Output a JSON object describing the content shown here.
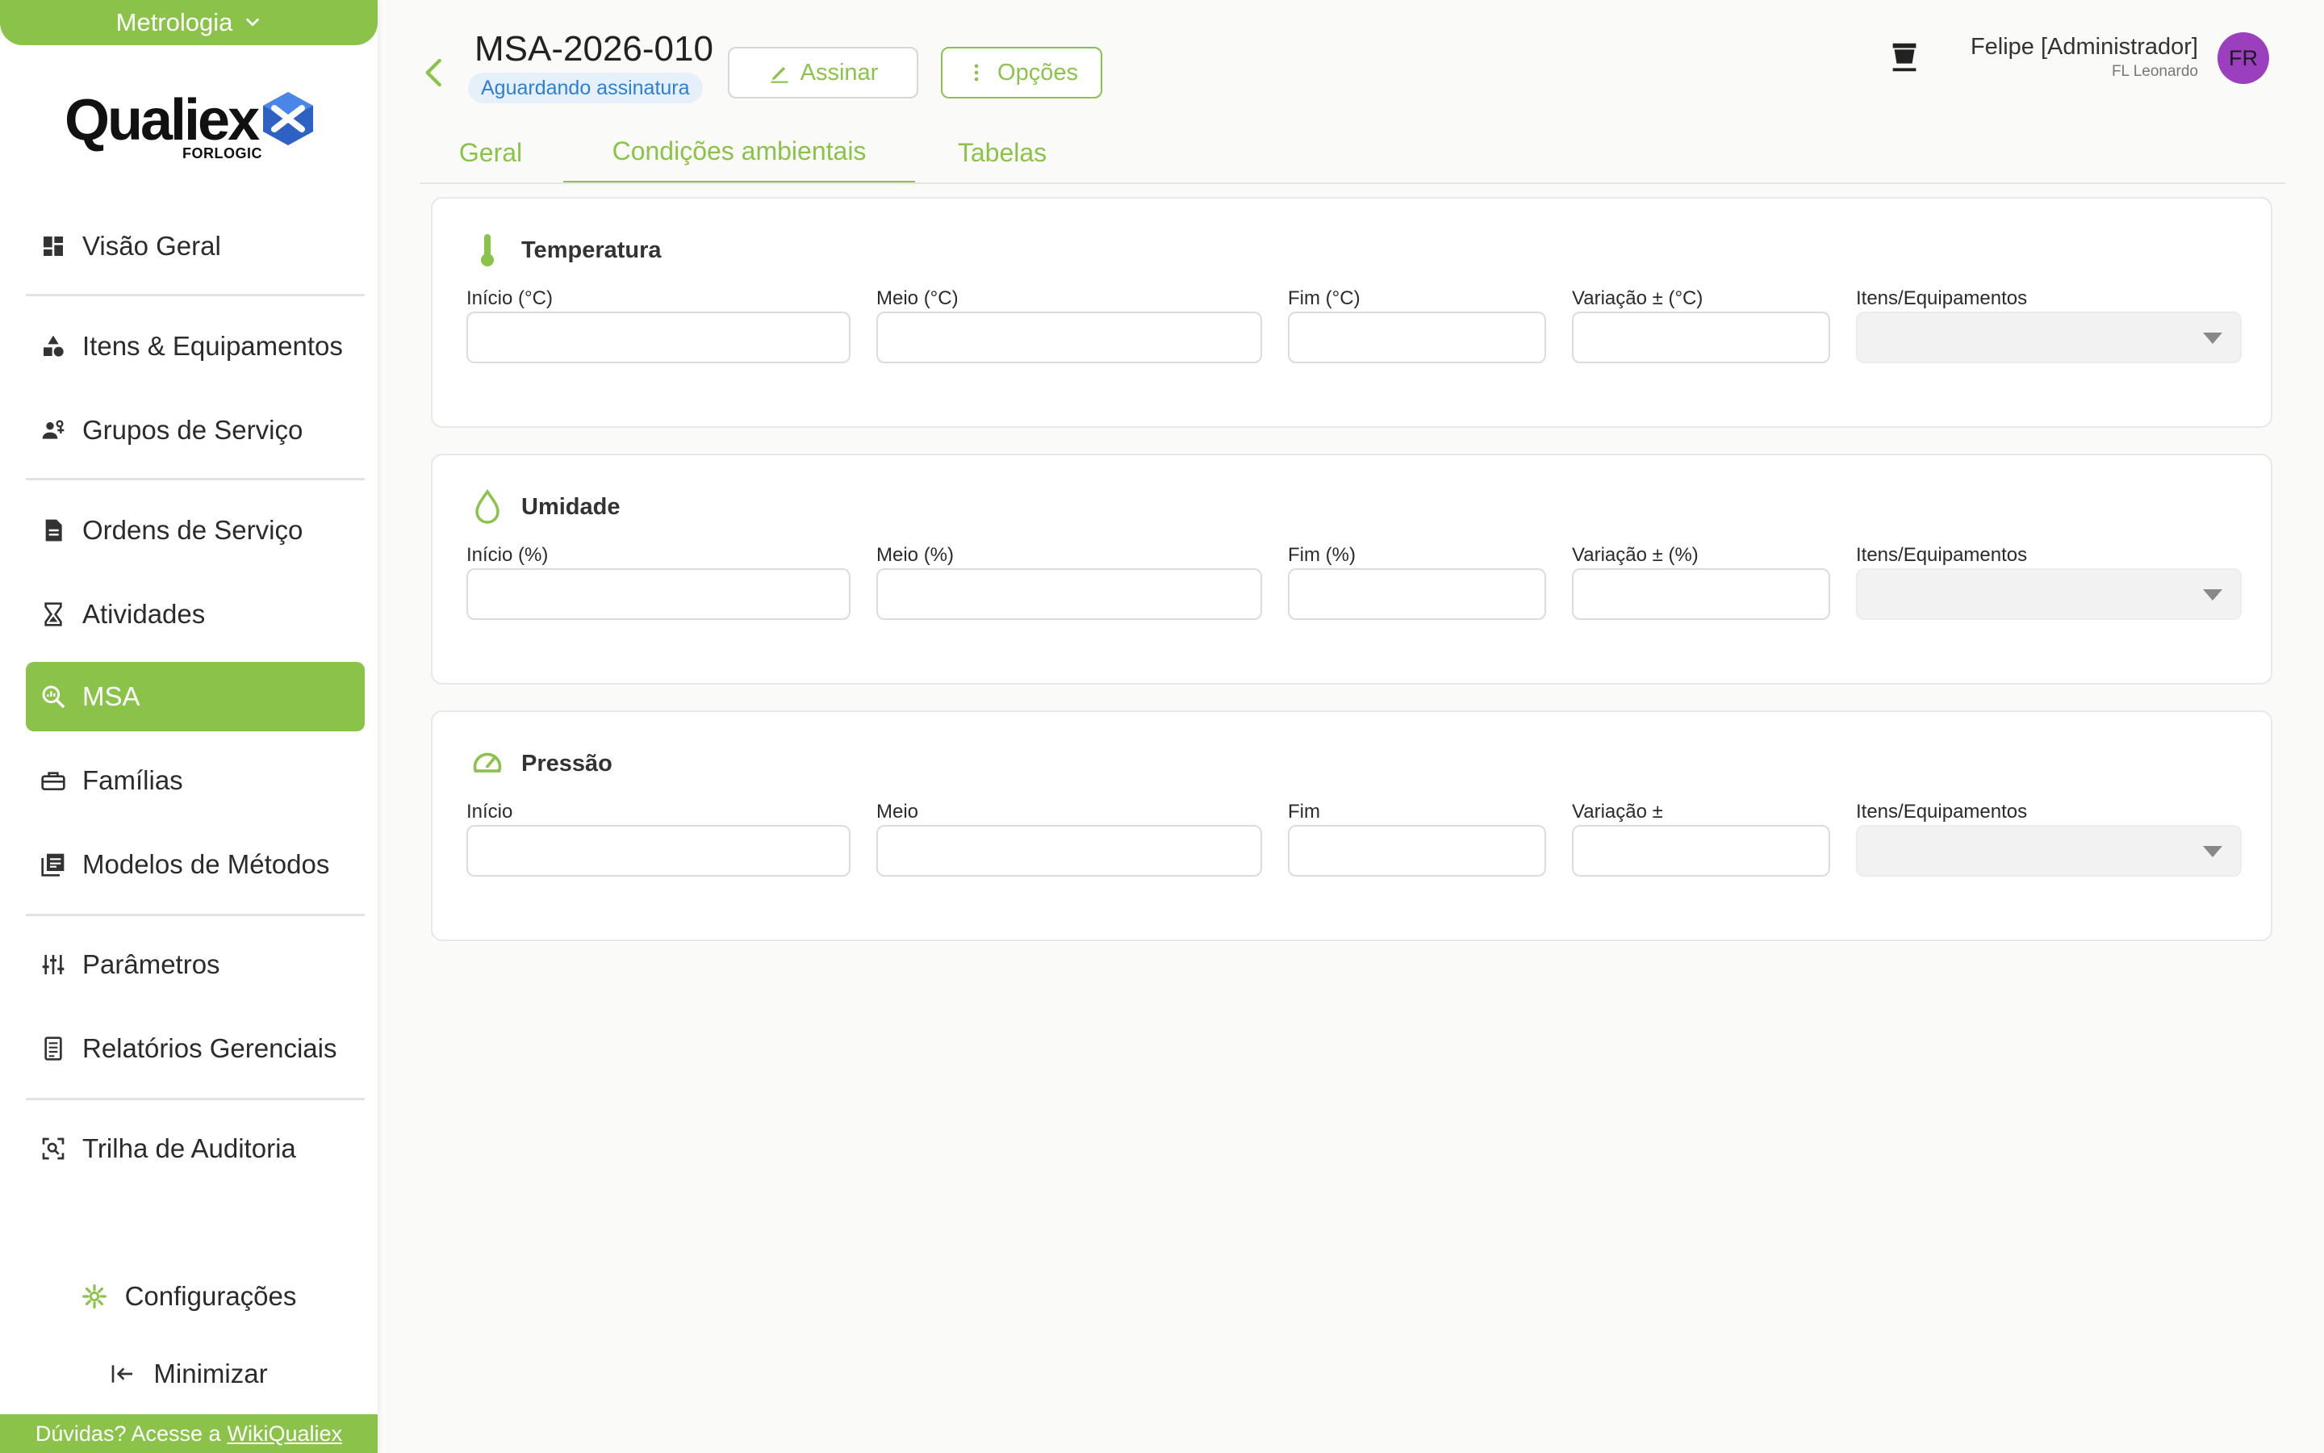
{
  "sidebar": {
    "module": "Metrologia",
    "logo": {
      "word": "Qualiex",
      "sub": "FORLOGIC"
    },
    "items": [
      {
        "label": "Visão Geral",
        "icon": "dashboard-icon"
      },
      {
        "label": "Itens & Equipamentos",
        "icon": "shapes-icon"
      },
      {
        "label": "Grupos de Serviço",
        "icon": "group-icon"
      },
      {
        "label": "Ordens de Serviço",
        "icon": "document-icon"
      },
      {
        "label": "Atividades",
        "icon": "hourglass-icon"
      },
      {
        "label": "MSA",
        "icon": "zoom-chart-icon",
        "active": true
      },
      {
        "label": "Famílias",
        "icon": "toolbox-icon"
      },
      {
        "label": "Modelos de Métodos",
        "icon": "library-icon"
      },
      {
        "label": "Parâmetros",
        "icon": "sliders-icon"
      },
      {
        "label": "Relatórios Gerenciais",
        "icon": "report-icon"
      },
      {
        "label": "Trilha de Auditoria",
        "icon": "audit-scan-icon"
      }
    ],
    "settings_label": "Configurações",
    "minimize_label": "Minimizar",
    "help": {
      "prefix": "Dúvidas? Acesse a",
      "link": "WikiQualiex"
    }
  },
  "header": {
    "title": "MSA-2026-010",
    "status": "Aguardando assinatura",
    "sign_label": "Assinar",
    "options_label": "Opções",
    "user_name": "Felipe [Administrador]",
    "user_company": "FL Leonardo",
    "avatar_initials": "FR"
  },
  "tabs": [
    {
      "label": "Geral"
    },
    {
      "label": "Condições ambientais",
      "active": true
    },
    {
      "label": "Tabelas"
    }
  ],
  "sections": [
    {
      "title": "Temperatura",
      "icon": "thermometer-icon",
      "fields": [
        "Início (°C)",
        "Meio (°C)",
        "Fim (°C)",
        "Variação ± (°C)",
        "Itens/Equipamentos"
      ]
    },
    {
      "title": "Umidade",
      "icon": "droplet-icon",
      "fields": [
        "Início (%)",
        "Meio (%)",
        "Fim (%)",
        "Variação ± (%)",
        "Itens/Equipamentos"
      ]
    },
    {
      "title": "Pressão",
      "icon": "gauge-icon",
      "fields": [
        "Início",
        "Meio",
        "Fim",
        "Variação ±",
        "Itens/Equipamentos"
      ]
    }
  ],
  "colors": {
    "brand": "#8bc34a",
    "status_bg": "#e5f0fb",
    "status_text": "#2f7fd1",
    "avatar": "#9c3fbf"
  }
}
